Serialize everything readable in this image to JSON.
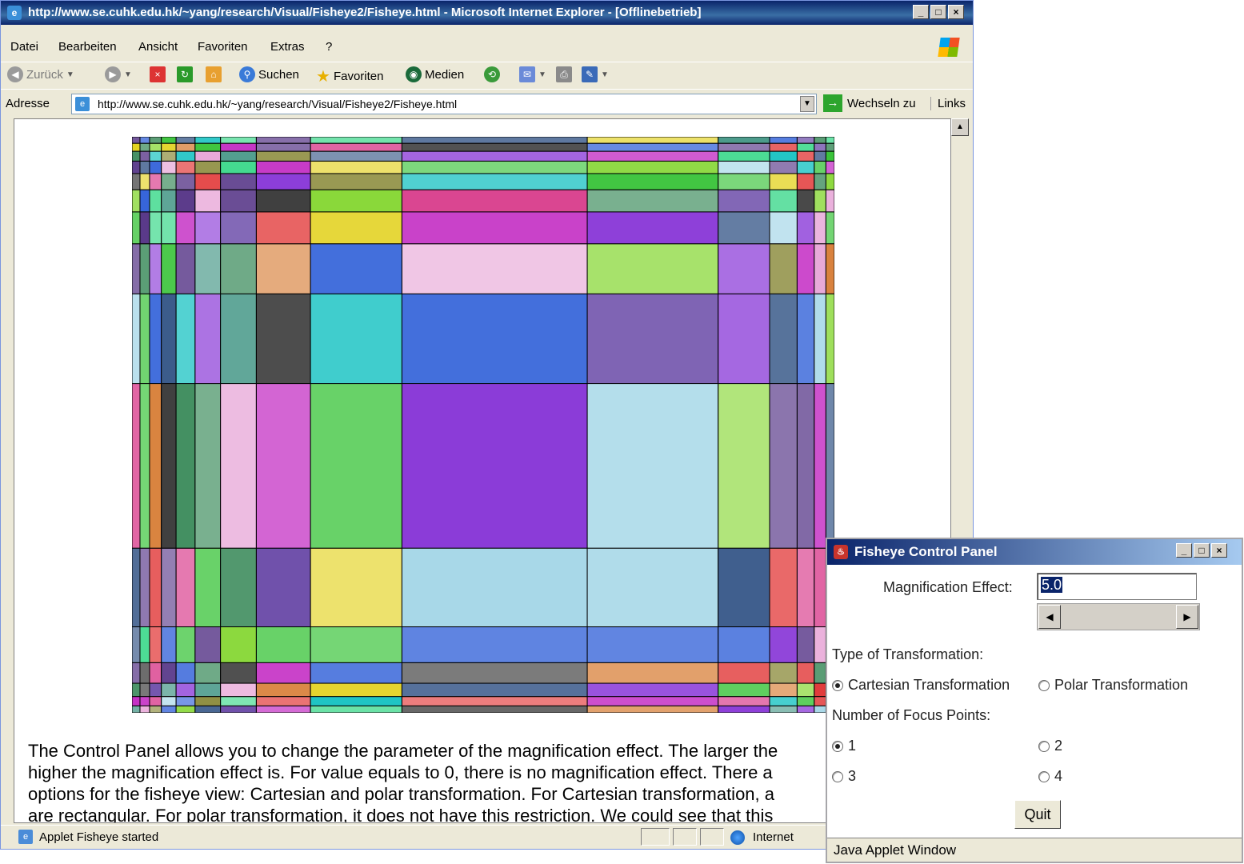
{
  "browser": {
    "title": "http://www.se.cuhk.edu.hk/~yang/research/Visual/Fisheye2/Fisheye.html - Microsoft Internet Explorer - [Offlinebetrieb]",
    "menu": [
      "Datei",
      "Bearbeiten",
      "Ansicht",
      "Favoriten",
      "Extras",
      "?"
    ],
    "toolbar": {
      "back": "Zurück",
      "search": "Suchen",
      "favorites": "Favoriten",
      "media": "Medien"
    },
    "address": {
      "label": "Adresse",
      "url": "http://www.se.cuhk.edu.hk/~yang/research/Visual/Fisheye2/Fisheye.html",
      "go": "Wechseln zu",
      "links": "Links"
    },
    "description_lines": [
      "The Control Panel allows you to change the parameter of the magnification effect. The larger the",
      "higher the magnification effect is. For value equals to 0, there is no magnification effect. There a",
      "options for the fisheye view: Cartesian and polar transformation. For Cartesian transformation, a",
      "are rectangular. For polar transformation, it does not have this restriction. We could see that this"
    ],
    "status": {
      "text": "Applet Fisheye started",
      "zone": "Internet"
    }
  },
  "control_panel": {
    "title": "Fisheye Control Panel",
    "magnification_label": "Magnification Effect:",
    "magnification_value": "5.0",
    "transformation_label": "Type of Transformation:",
    "transformations": [
      {
        "label": "Cartesian Transformation",
        "selected": true
      },
      {
        "label": "Polar Transformation",
        "selected": false
      }
    ],
    "focus_label": "Number of Focus Points:",
    "focus_options": [
      {
        "label": "1",
        "selected": true
      },
      {
        "label": "2",
        "selected": false
      },
      {
        "label": "3",
        "selected": false
      },
      {
        "label": "4",
        "selected": false
      }
    ],
    "quit_label": "Quit",
    "status": "Java Applet Window"
  },
  "colors": {
    "palette": [
      "#e23a3a",
      "#3ac43a",
      "#2f5fd8",
      "#e3d21f",
      "#c42fc4",
      "#1fc4c4",
      "#8a3ad8",
      "#d8803a",
      "#3a8a5a",
      "#5a3a8a",
      "#8ad83a",
      "#3a5a8a",
      "#d83a8a",
      "#3ad88a",
      "#8a8a3a",
      "#3a3a3a",
      "#a8d8e8",
      "#e8a8d8",
      "#4a9a8a",
      "#6a4aa8"
    ]
  }
}
